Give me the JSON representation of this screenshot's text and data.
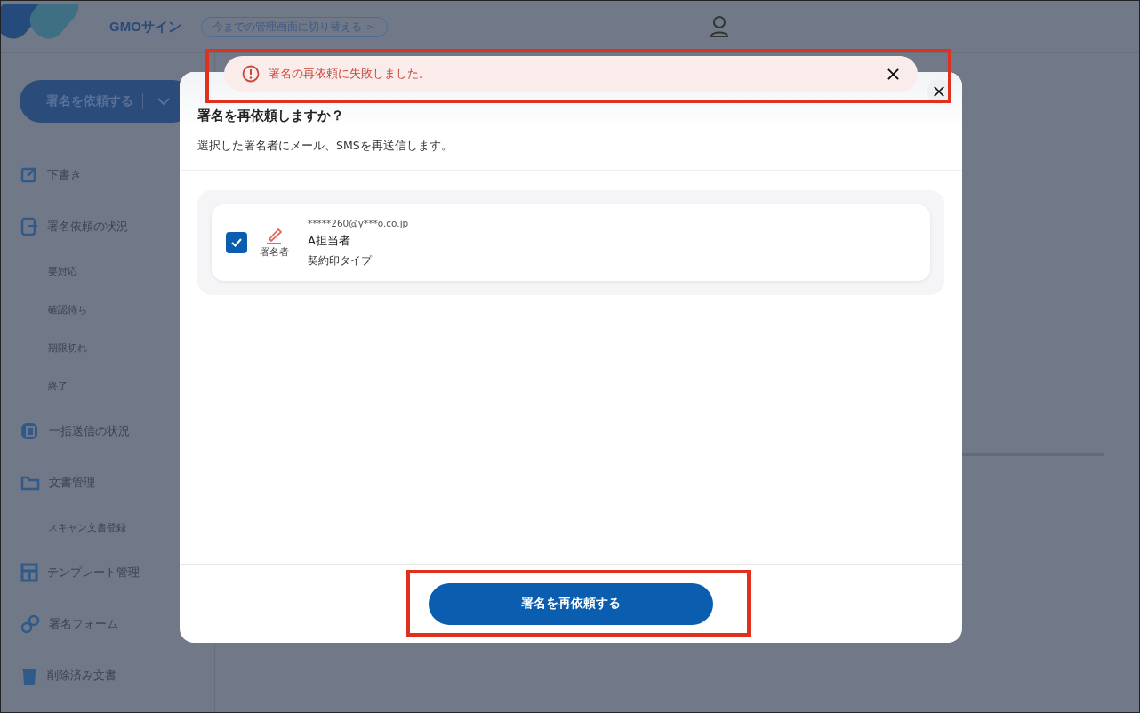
{
  "header": {
    "logo": "GMOサイン",
    "switch_link": "今までの管理画面に切り替える ＞"
  },
  "request_button": {
    "label": "署名を依頼する"
  },
  "sidebar": {
    "items": [
      {
        "label": "下書き"
      },
      {
        "label": "署名依頼の状況",
        "children": [
          {
            "label": "要対応"
          },
          {
            "label": "確認待ち"
          },
          {
            "label": "期限切れ"
          },
          {
            "label": "終了"
          }
        ]
      },
      {
        "label": "一括送信の状況"
      },
      {
        "label": "文書管理",
        "children": [
          {
            "label": "スキャン文書登録"
          }
        ]
      },
      {
        "label": "テンプレート管理"
      },
      {
        "label": "署名フォーム"
      },
      {
        "label": "削除済み文書"
      }
    ]
  },
  "toast": {
    "message": "署名の再依頼に失敗しました。"
  },
  "dialog": {
    "title": "署名を再依頼しますか？",
    "description": "選択した署名者にメール、SMSを再送信します。",
    "signers": [
      {
        "checked": true,
        "role": "署名者",
        "email": "*****260@y***o.co.jp",
        "name": "A担当者",
        "type": "契約印タイプ"
      }
    ],
    "submit": "署名を再依頼する"
  }
}
